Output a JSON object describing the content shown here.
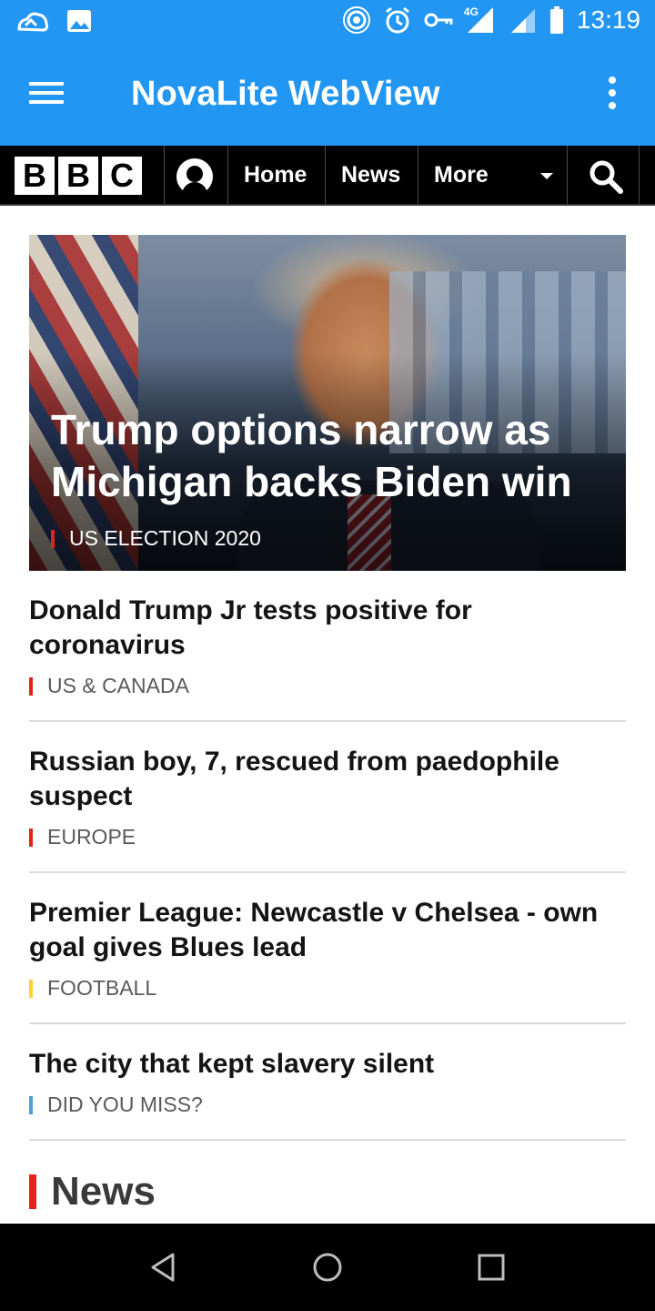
{
  "status_bar": {
    "time": "13:19",
    "network": "4G",
    "left_icons": [
      "cloud-icon",
      "image-icon"
    ],
    "right_icons": [
      "hotspot-icon",
      "alarm-icon",
      "vpn-key-icon",
      "signal-icon",
      "signal-icon",
      "battery-icon"
    ]
  },
  "app_bar": {
    "title": "NovaLite WebView",
    "menu_icon": "hamburger-menu-icon",
    "overflow_icon": "more-vert-icon"
  },
  "bbc_nav": {
    "logo_letters": [
      "B",
      "B",
      "C"
    ],
    "items": [
      "Home",
      "News",
      "More"
    ],
    "account_icon": "account-icon",
    "search_icon": "search-icon"
  },
  "hero": {
    "title": "Trump options narrow as Michigan backs Biden win",
    "tag": "US ELECTION 2020",
    "tag_color": "#e0241c"
  },
  "stories": [
    {
      "title": "Donald Trump Jr tests positive for coronavirus",
      "tag": "US & CANADA",
      "tag_color": "#e0241c"
    },
    {
      "title": "Russian boy, 7, rescued from paedophile suspect",
      "tag": "EUROPE",
      "tag_color": "#e0241c"
    },
    {
      "title": "Premier League: Newcastle v Chelsea - own goal gives Blues lead",
      "tag": "FOOTBALL",
      "tag_color": "#ffd230"
    },
    {
      "title": "The city that kept slavery silent",
      "tag": "DID YOU MISS?",
      "tag_color": "#4ea0d8"
    }
  ],
  "section": {
    "label": "News",
    "color": "#e0241c"
  },
  "android_nav": {
    "icons": [
      "back-icon",
      "home-icon",
      "recents-icon"
    ]
  },
  "colors": {
    "app_bar": "#2196f3",
    "bbc_nav": "#000000",
    "accent_red": "#e0241c"
  }
}
